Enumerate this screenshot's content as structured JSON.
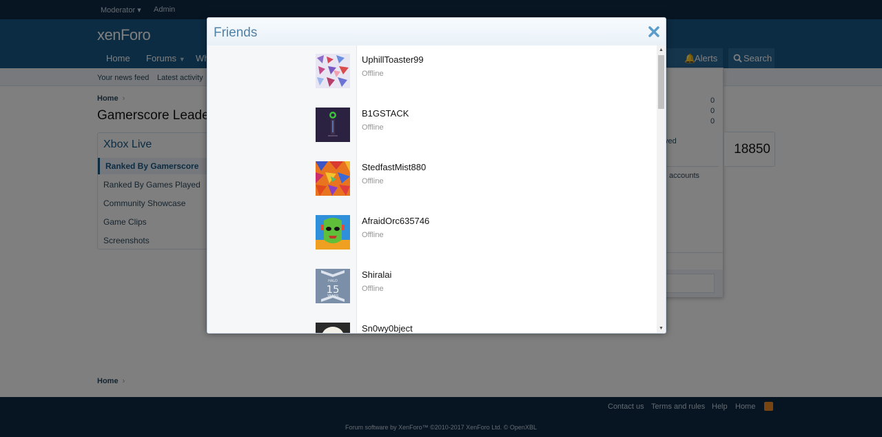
{
  "topbar": {
    "moderator": "Moderator",
    "admin": "Admin"
  },
  "header": {
    "logo": "xenForo",
    "nav": {
      "home": "Home",
      "forums": "Forums",
      "whats_new": "Wh",
      "alerts": "Alerts",
      "search": "Search"
    }
  },
  "subnav": {
    "news_feed": "Your news feed",
    "latest_activity": "Latest activity"
  },
  "breadcrumb": {
    "home": "Home"
  },
  "page_title": "Gamerscore Leade",
  "sidebar": {
    "title": "Xbox Live",
    "items": [
      {
        "label": "Ranked By Gamerscore",
        "active": true
      },
      {
        "label": "Ranked By Games Played",
        "active": false
      },
      {
        "label": "Community Showcase",
        "active": false
      },
      {
        "label": "Game Clips",
        "active": false
      },
      {
        "label": "Screenshots",
        "active": false
      }
    ]
  },
  "alerts_panel": {
    "counts": [
      "0",
      "0",
      "0"
    ],
    "played_fragment": "yed",
    "accounts_fragment": "accounts",
    "t_fragment": "t"
  },
  "score": "18850",
  "modal": {
    "title": "Friends",
    "close_icon": "close-icon",
    "friends": [
      {
        "name": "UphillToaster99",
        "status": "Offline",
        "avatar": "abstract-blue-red-mosaic"
      },
      {
        "name": "B1GSTACK",
        "status": "Offline",
        "avatar": "xbox-figure-dark-purple"
      },
      {
        "name": "StedfastMist880",
        "status": "Offline",
        "avatar": "colorful-mosaic"
      },
      {
        "name": "AfraidOrc635746",
        "status": "Offline",
        "avatar": "green-alien-face"
      },
      {
        "name": "Shiralai",
        "status": "Offline",
        "avatar": "halo-15-years"
      },
      {
        "name": "Sn0wy0bject",
        "status": "",
        "avatar": "light-photo"
      }
    ]
  },
  "footer": {
    "contact": "Contact us",
    "terms": "Terms and rules",
    "help": "Help",
    "home": "Home",
    "copyright": "Forum software by XenForo™ ©2010-2017 XenForo Ltd. © OpenXBL"
  },
  "colors": {
    "header_blue": "#185886",
    "topbar_navy": "#0f2a46",
    "modal_title": "#5082a8"
  }
}
